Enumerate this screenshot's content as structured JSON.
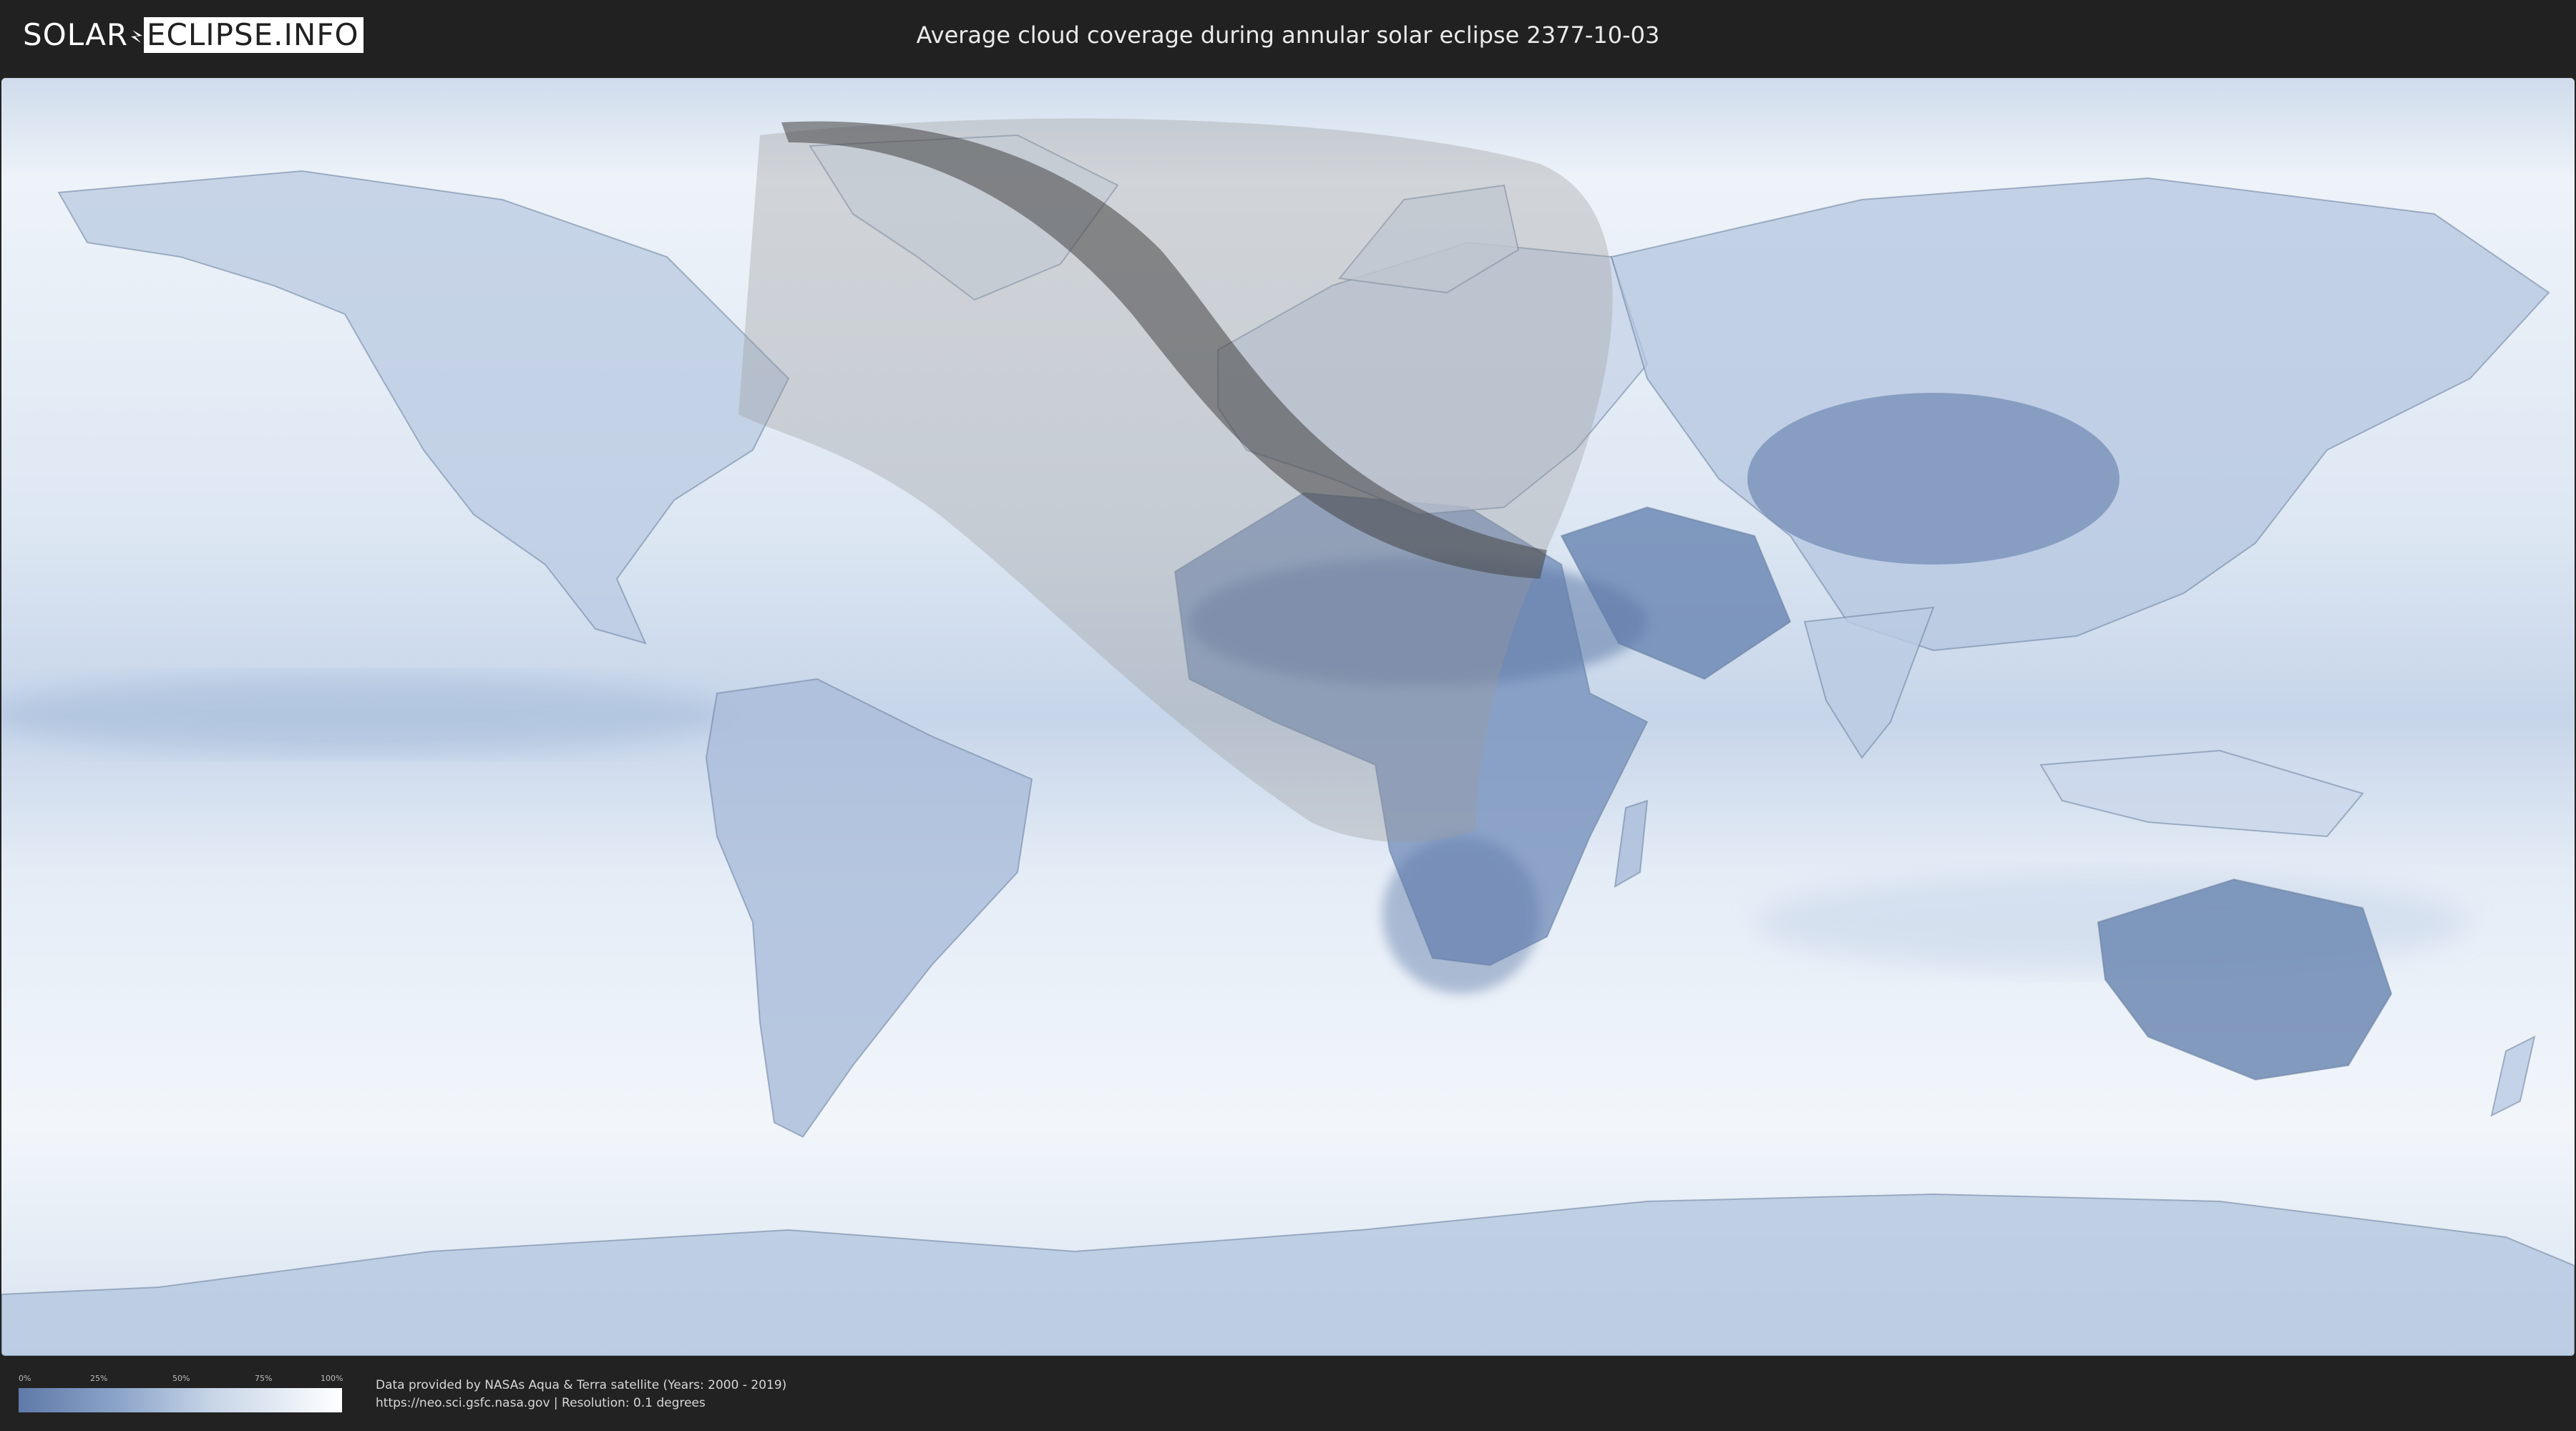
{
  "header": {
    "logo_left": "SOLAR",
    "logo_right": "ECLIPSE.INFO",
    "title": "Average cloud coverage during annular solar eclipse 2377-10-03"
  },
  "legend": {
    "ticks": [
      "0%",
      "25%",
      "50%",
      "75%",
      "100%"
    ],
    "colors": {
      "low": "#5f7aa8",
      "mid": "#c7d5e7",
      "high": "#ffffff"
    }
  },
  "credits": {
    "line1": "Data provided by NASAs Aqua & Terra satellite (Years: 2000 - 2019)",
    "line2": "https://neo.sci.gsfc.nasa.gov | Resolution: 0.1 degrees"
  },
  "map": {
    "colors": {
      "ocean_cloud": "#e8f0f8",
      "clear_land": "#5b78a6",
      "mid_cloud": "#9fb6d6",
      "penumbra_overlay": "#9a9a9a",
      "annular_path": "#444444"
    },
    "icons": [
      "eclipse-penumbra-shading",
      "annular-path-band"
    ]
  }
}
